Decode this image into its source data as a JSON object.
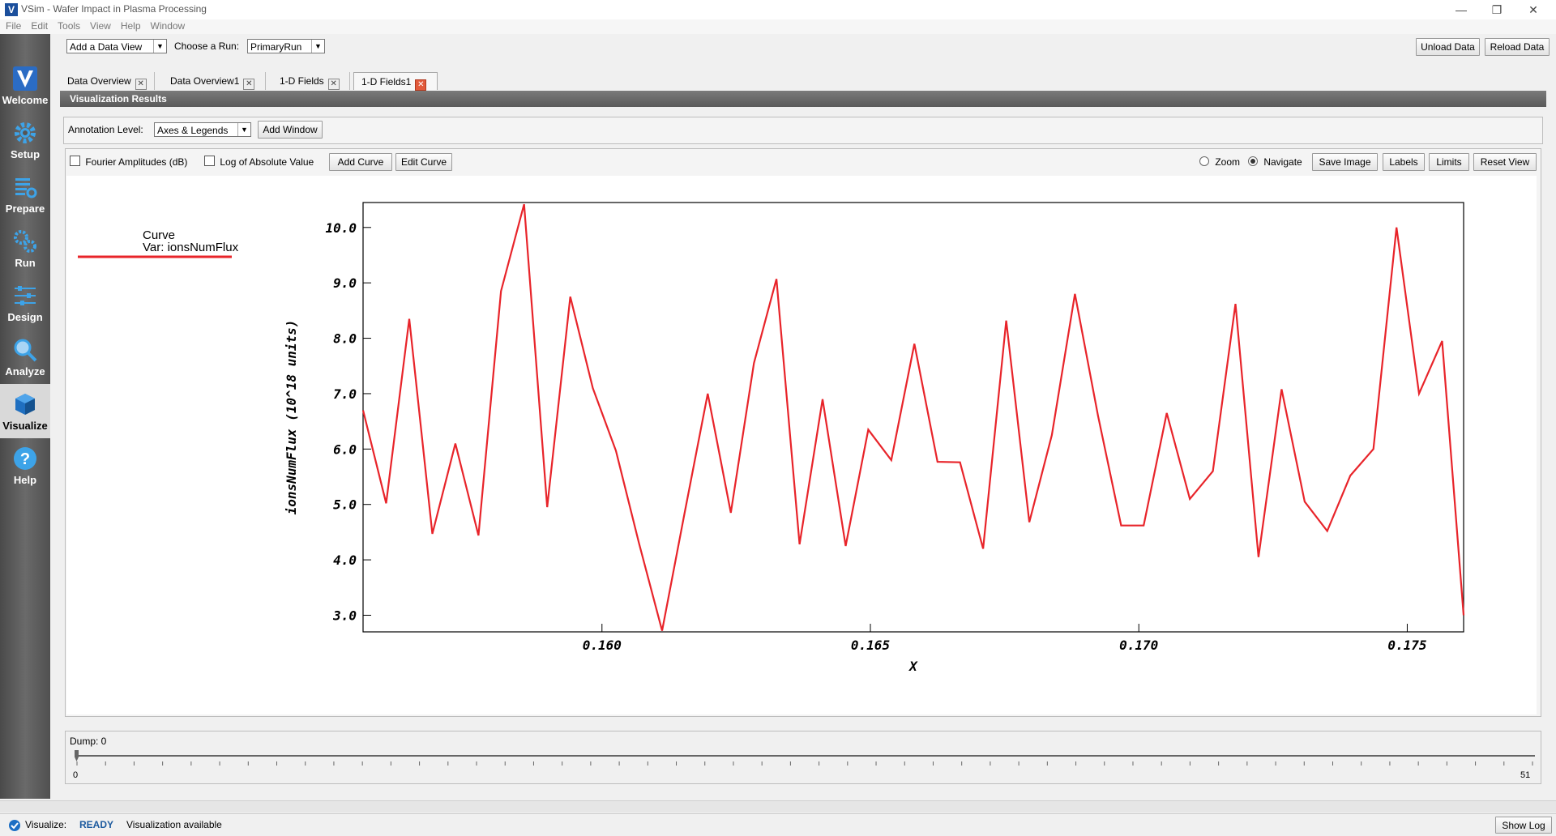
{
  "window": {
    "title": "VSim - Wafer Impact in Plasma Processing",
    "logo_letter": "V"
  },
  "menu": [
    "File",
    "Edit",
    "Tools",
    "View",
    "Help",
    "Window"
  ],
  "sidebar": {
    "items": [
      {
        "label": "Welcome",
        "icon": "vsim-logo-icon"
      },
      {
        "label": "Setup",
        "icon": "gear-icon"
      },
      {
        "label": "Prepare",
        "icon": "list-gear-icon"
      },
      {
        "label": "Run",
        "icon": "gears-icon"
      },
      {
        "label": "Design",
        "icon": "sliders-icon"
      },
      {
        "label": "Analyze",
        "icon": "magnifier-icon"
      },
      {
        "label": "Visualize",
        "icon": "cube-icon"
      },
      {
        "label": "Help",
        "icon": "question-icon"
      }
    ],
    "active": "Visualize"
  },
  "toolbar": {
    "data_view": "Add a Data View",
    "choose_run_label": "Choose a Run:",
    "run_value": "PrimaryRun",
    "unload": "Unload Data",
    "reload": "Reload Data"
  },
  "tabs": [
    {
      "label": "Data Overview"
    },
    {
      "label": "Data Overview1"
    },
    {
      "label": "1-D Fields"
    },
    {
      "label": "1-D Fields1"
    }
  ],
  "viz_header": "Visualization Results",
  "annotation": {
    "label": "Annotation Level:",
    "value": "Axes & Legends",
    "add_window": "Add Window"
  },
  "plot_toolbar": {
    "fourier": "Fourier Amplitudes (dB)",
    "log_abs": "Log of Absolute Value",
    "add_curve": "Add Curve",
    "edit_curve": "Edit Curve",
    "zoom": "Zoom",
    "navigate": "Navigate",
    "save_image": "Save Image",
    "labels": "Labels",
    "limits": "Limits",
    "reset_view": "Reset View"
  },
  "chart_data": {
    "type": "line",
    "title": "",
    "xlabel": "X",
    "ylabel": "ionsNumFlux (10^18 units)",
    "xlim": [
      0.15555,
      0.17605
    ],
    "ylim": [
      2.7,
      10.45
    ],
    "xticks": [
      "0.160",
      "0.165",
      "0.170",
      "0.175"
    ],
    "xtick_values": [
      0.16,
      0.165,
      0.17,
      0.175
    ],
    "yticks": [
      "3.0",
      "4.0",
      "5.0",
      "6.0",
      "7.0",
      "8.0",
      "9.0",
      "10.0"
    ],
    "ytick_values": [
      3,
      4,
      5,
      6,
      7,
      8,
      9,
      10
    ],
    "line_color": "#e8242a",
    "legend": {
      "line1": "Curve",
      "line2": "Var: ionsNumFlux"
    },
    "series": [
      {
        "x": [
          0.15555,
          0.15598,
          0.15641,
          0.15684,
          0.15727,
          0.1577,
          0.15812,
          0.15855,
          0.15898,
          0.15941,
          0.15983,
          0.16026,
          0.16069,
          0.16112,
          0.16154,
          0.16197,
          0.1624,
          0.16283,
          0.16325,
          0.16368,
          0.16411,
          0.16454,
          0.16496,
          0.16539,
          0.16582,
          0.16625,
          0.16667,
          0.1671,
          0.16753,
          0.16796,
          0.16838,
          0.16881,
          0.16924,
          0.16967,
          0.17009,
          0.17052,
          0.17095,
          0.17138,
          0.1718,
          0.17223,
          0.17266,
          0.17309,
          0.17351,
          0.17394,
          0.17437,
          0.1748,
          0.17522,
          0.17565,
          0.17605
        ],
        "y": [
          6.7,
          5.02,
          8.35,
          4.47,
          6.1,
          4.44,
          8.85,
          10.42,
          4.95,
          8.75,
          7.1,
          5.97,
          4.3,
          2.72,
          4.85,
          7.0,
          4.85,
          7.55,
          9.07,
          4.28,
          6.9,
          4.25,
          6.35,
          5.8,
          7.9,
          5.77,
          5.76,
          4.2,
          8.32,
          4.68,
          6.25,
          8.8,
          6.6,
          4.62,
          4.62,
          6.65,
          5.1,
          5.6,
          8.62,
          4.05,
          7.08,
          5.05,
          4.52,
          5.52,
          6.0,
          10.0,
          7.0,
          7.95,
          3.0
        ]
      }
    ]
  },
  "dump": {
    "label": "Dump: 0",
    "min": "0",
    "max": "51"
  },
  "status": {
    "module": "Visualize:",
    "state": "READY",
    "message": "Visualization available",
    "show_log": "Show Log"
  }
}
